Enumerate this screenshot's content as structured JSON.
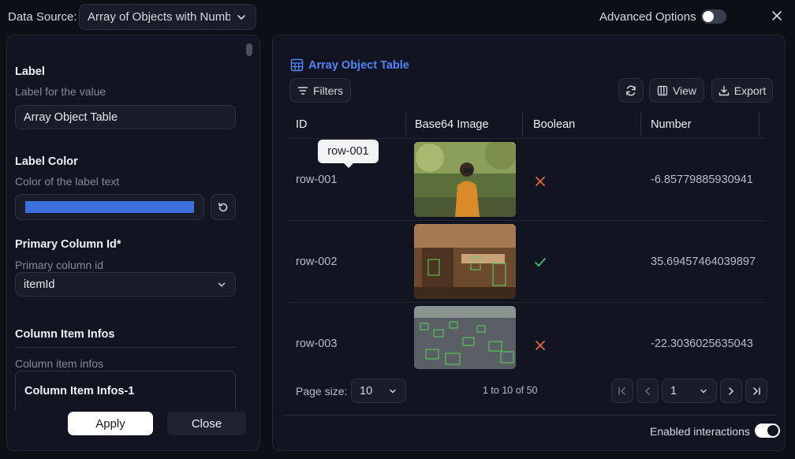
{
  "topbar": {
    "data_source_label": "Data Source:",
    "data_source_value": "Array of Objects with Numbe",
    "advanced_options_label": "Advanced Options",
    "advanced_options_on": false
  },
  "left": {
    "label_title": "Label",
    "label_desc": "Label for the value",
    "label_value": "Array Object Table",
    "label_color_title": "Label Color",
    "label_color_desc": "Color of the label text",
    "label_color_value": "#3b6fde",
    "primary_col_title": "Primary Column Id*",
    "primary_col_desc": "Primary column id",
    "primary_col_value": "itemId",
    "column_infos_title": "Column Item Infos",
    "column_infos_desc": "Column item infos",
    "column_infos_sub": "Column Item Infos-1",
    "apply_label": "Apply",
    "close_label": "Close"
  },
  "table": {
    "title": "Array Object Table",
    "filters_label": "Filters",
    "view_label": "View",
    "export_label": "Export",
    "columns": [
      "ID",
      "Base64 Image",
      "Boolean",
      "Number"
    ],
    "rows": [
      {
        "id": "row-001",
        "boolean": false,
        "number": "-6.85779885930941"
      },
      {
        "id": "row-002",
        "boolean": true,
        "number": "35.69457464039897"
      },
      {
        "id": "row-003",
        "boolean": false,
        "number": "-22.3036025635043"
      }
    ],
    "tooltip": "row-001"
  },
  "pager": {
    "page_size_label": "Page size:",
    "page_size": "10",
    "range": "1 to 10 of 50",
    "page": "1"
  },
  "footer": {
    "enabled_interactions_label": "Enabled interactions",
    "enabled_interactions_on": true
  },
  "colors": {
    "accent": "#4f86f7",
    "false_icon": "#e8663d",
    "true_icon": "#3fbf6f"
  }
}
